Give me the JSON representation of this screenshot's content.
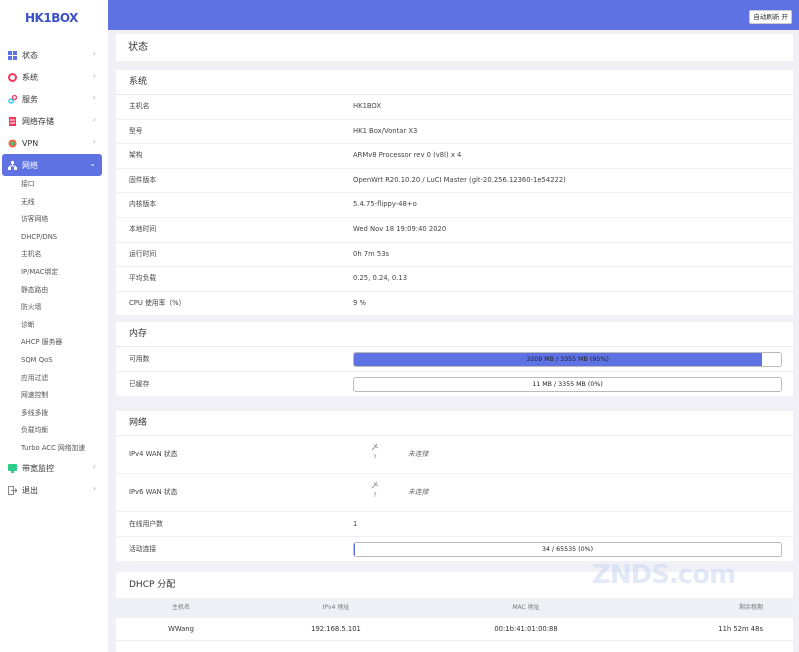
{
  "app": {
    "logo": "HK1BOX"
  },
  "topbar": {
    "refresh_label": "自动刷新 开"
  },
  "sidebar": {
    "items": [
      {
        "label": "状态"
      },
      {
        "label": "系统"
      },
      {
        "label": "服务"
      },
      {
        "label": "网络存储"
      },
      {
        "label": "VPN"
      },
      {
        "label": "网络"
      },
      {
        "label": "带宽监控"
      },
      {
        "label": "退出"
      }
    ],
    "network_sub": [
      "接口",
      "无线",
      "访客网络",
      "DHCP/DNS",
      "主机名",
      "IP/MAC绑定",
      "静态路由",
      "防火墙",
      "诊断",
      "AHCP 服务器",
      "SQM QoS",
      "应用过滤",
      "网速控制",
      "多线多拨",
      "负载均衡",
      "Turbo ACC 网络加速"
    ]
  },
  "page": {
    "title": "状态"
  },
  "system": {
    "title": "系统",
    "rows": [
      {
        "k": "主机名",
        "v": "HK1BOX"
      },
      {
        "k": "型号",
        "v": "HK1 Box/Vontar X3"
      },
      {
        "k": "架构",
        "v": "ARMv8 Processor rev 0 (v8l) x 4"
      },
      {
        "k": "固件版本",
        "v": "OpenWrt R20.10.20 / LuCI Master (git-20.256.12360-1e54222)"
      },
      {
        "k": "内核版本",
        "v": "5.4.75-flippy-48+o"
      },
      {
        "k": "本地时间",
        "v": "Wed Nov 18 19:09:40 2020"
      },
      {
        "k": "运行时间",
        "v": "0h 7m 53s"
      },
      {
        "k": "平均负载",
        "v": "0.25, 0.24, 0.13"
      },
      {
        "k": "CPU 使用率（%）",
        "v": "9 %"
      }
    ]
  },
  "memory": {
    "title": "内存",
    "rows": [
      {
        "k": "可用数",
        "v": "3209 MB / 3355 MB (95%)",
        "fill": 0.956
      },
      {
        "k": "已缓存",
        "v": "11 MB / 3355 MB (0%)",
        "fill": 0.0
      }
    ]
  },
  "network": {
    "title": "网络",
    "ipv4": {
      "k": "IPv4 WAN 状态",
      "icon_text": "?",
      "status": "未连接"
    },
    "ipv6": {
      "k": "IPv6 WAN 状态",
      "icon_text": "?",
      "status": "未连接"
    },
    "online_users": {
      "k": "在线用户数",
      "v": "1"
    },
    "connections": {
      "k": "活动连接",
      "v": "34 / 65535 (0%)",
      "fill": 0.0005
    }
  },
  "dhcp": {
    "title": "DHCP 分配",
    "columns": [
      "主机名",
      "IPv4 地址",
      "MAC 地址",
      "剩余租期"
    ],
    "rows": [
      {
        "host": "WWang",
        "ip": "192.168.5.101",
        "mac": "00:1b:41:01:00:88",
        "lease": "11h 52m 48s"
      }
    ]
  },
  "watermark": "ZNDS.com",
  "colors": {
    "accent": "#5e72e4",
    "logo": "#3b51c8"
  }
}
